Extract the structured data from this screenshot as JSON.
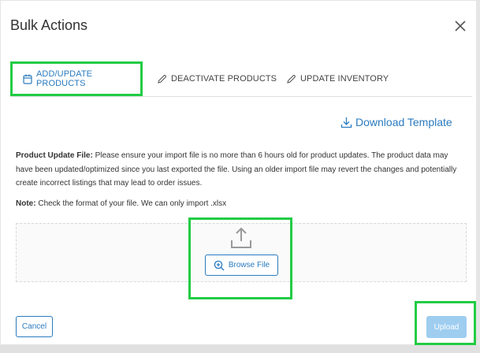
{
  "modal": {
    "title": "Bulk Actions",
    "close_icon": "close-icon"
  },
  "tabs": [
    {
      "label": "ADD/UPDATE PRODUCTS",
      "icon": "calendar-icon",
      "active": true
    },
    {
      "label": "DEACTIVATE PRODUCTS",
      "icon": "pencil-icon",
      "active": false
    },
    {
      "label": "UPDATE INVENTORY",
      "icon": "pencil-icon",
      "active": false
    }
  ],
  "download": {
    "label": "Download Template",
    "icon": "download-icon"
  },
  "info": {
    "bold_label": "Product Update File:",
    "text": " Please ensure your import file is no more than 6 hours old for product updates. The product data may have been updated/optimized since you last exported the file. Using an older import file may revert the changes and potentially create incorrect listings that may lead to order issues."
  },
  "note": {
    "bold_label": "Note:",
    "text": " Check the format of your file. We can only import .xlsx"
  },
  "dropzone": {
    "browse_label": "Browse File",
    "upload_icon": "upload-icon",
    "browse_icon": "zoom-in-icon"
  },
  "footer": {
    "cancel_label": "Cancel",
    "upload_label": "Upload"
  },
  "colors": {
    "accent": "#2a7bbf",
    "highlight": "#22cc44",
    "upload_disabled": "#9ecdf0"
  }
}
